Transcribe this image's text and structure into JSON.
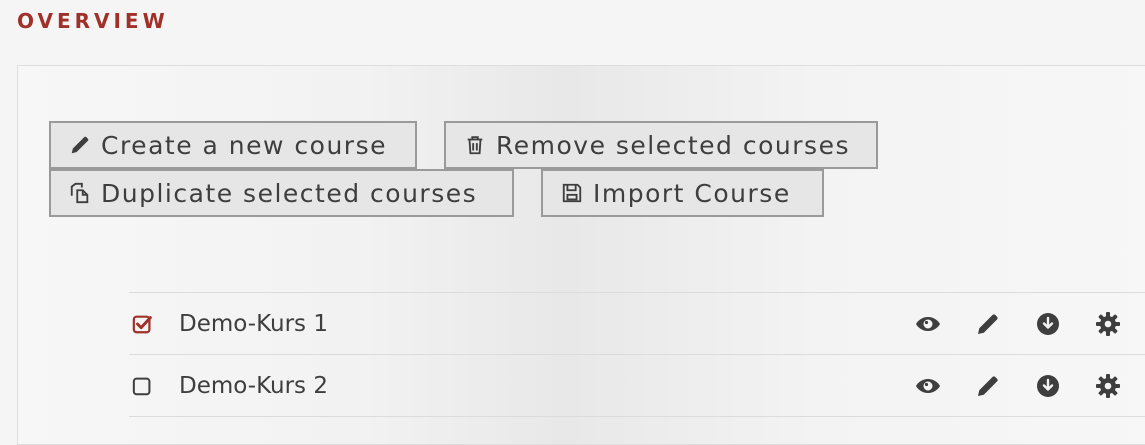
{
  "header": {
    "title": "OVERVIEW"
  },
  "toolbar": {
    "create_label": "Create a new course",
    "remove_label": "Remove selected courses",
    "duplicate_label": "Duplicate selected courses",
    "import_label": "Import Course"
  },
  "courses": [
    {
      "name": "Demo-Kurs 1",
      "checked": true
    },
    {
      "name": "Demo-Kurs 2",
      "checked": false
    }
  ],
  "colors": {
    "accent": "#a0312a",
    "icon": "#3e3e3e"
  },
  "icons": {
    "create": "pencil-icon",
    "remove": "trash-icon",
    "duplicate": "copy-icon",
    "import": "floppy-icon",
    "view": "eye-icon",
    "edit": "pencil-icon",
    "download": "download-icon",
    "settings": "gear-icon"
  }
}
